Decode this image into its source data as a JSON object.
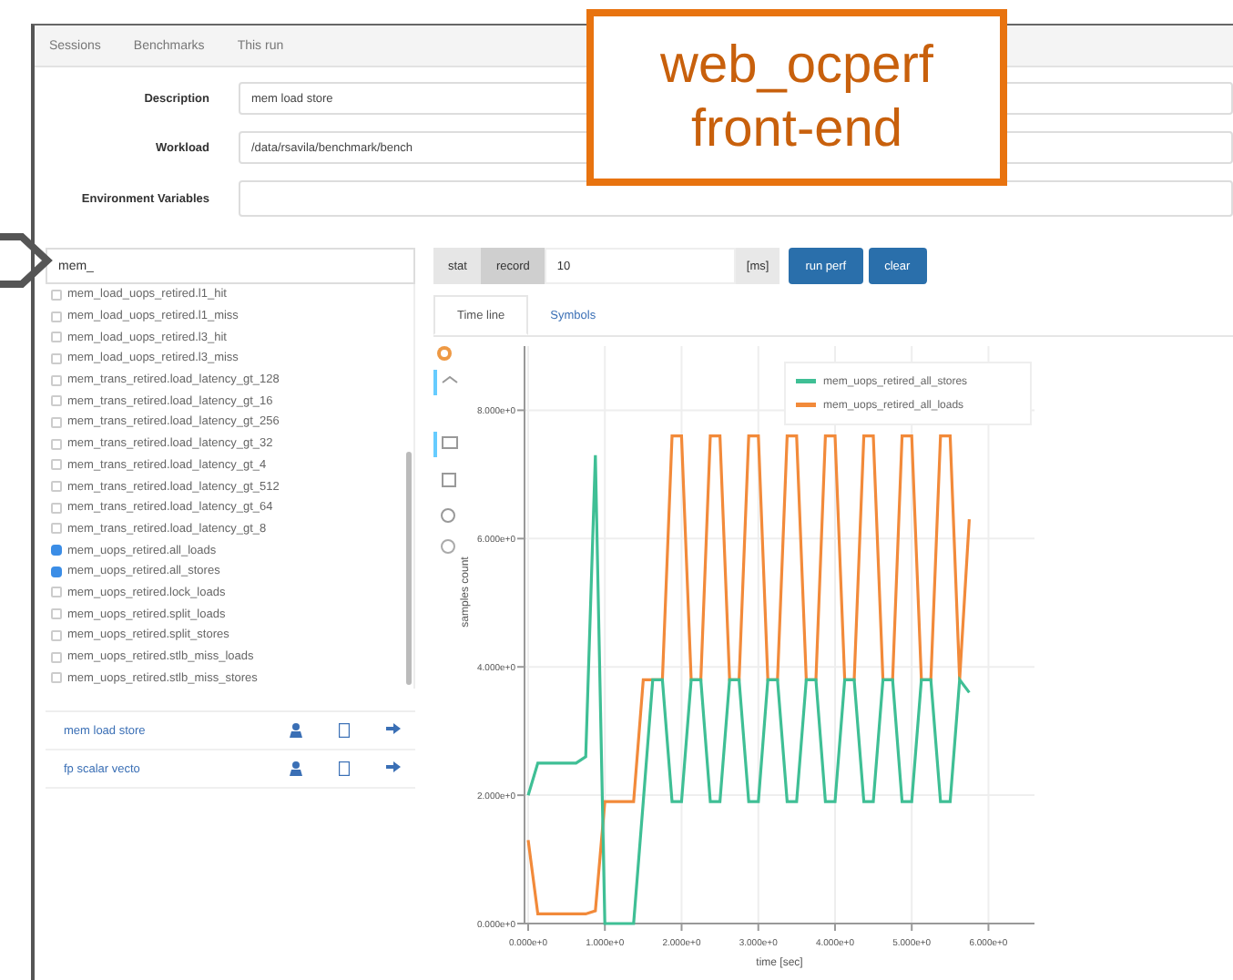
{
  "callout": {
    "lines": [
      "web_ocperf",
      "front-end"
    ]
  },
  "nav": [
    {
      "label": "Sessions"
    },
    {
      "label": "Benchmarks"
    },
    {
      "label": "This run"
    }
  ],
  "form": [
    {
      "label": "Description",
      "value": "mem load store"
    },
    {
      "label": "Workload",
      "value": "/data/rsavila/benchmark/bench"
    },
    {
      "label": "Environment Variables"
    }
  ],
  "filter": {
    "value": "mem_"
  },
  "events": [
    {
      "name": "mem_load_uops_retired.l1_hit",
      "checked": false
    },
    {
      "name": "mem_load_uops_retired.l1_miss",
      "checked": false
    },
    {
      "name": "mem_load_uops_retired.l3_hit",
      "checked": false
    },
    {
      "name": "mem_load_uops_retired.l3_miss",
      "checked": false
    },
    {
      "name": "mem_trans_retired.load_latency_gt_128",
      "checked": false
    },
    {
      "name": "mem_trans_retired.load_latency_gt_16",
      "checked": false
    },
    {
      "name": "mem_trans_retired.load_latency_gt_256",
      "checked": false
    },
    {
      "name": "mem_trans_retired.load_latency_gt_32",
      "checked": false
    },
    {
      "name": "mem_trans_retired.load_latency_gt_4",
      "checked": false
    },
    {
      "name": "mem_trans_retired.load_latency_gt_512",
      "checked": false
    },
    {
      "name": "mem_trans_retired.load_latency_gt_64",
      "checked": false
    },
    {
      "name": "mem_trans_retired.load_latency_gt_8",
      "checked": false
    },
    {
      "name": "mem_uops_retired.all_loads",
      "checked": true
    },
    {
      "name": "mem_uops_retired.all_stores",
      "checked": true
    },
    {
      "name": "mem_uops_retired.lock_loads",
      "checked": false
    },
    {
      "name": "mem_uops_retired.split_loads",
      "checked": false
    },
    {
      "name": "mem_uops_retired.split_stores",
      "checked": false
    },
    {
      "name": "mem_uops_retired.stlb_miss_loads",
      "checked": false
    },
    {
      "name": "mem_uops_retired.stlb_miss_stores",
      "checked": false
    }
  ],
  "saved": [
    {
      "name": "mem load store"
    },
    {
      "name": "fp scalar vecto"
    }
  ],
  "toolbar": {
    "modes": [
      {
        "label": "stat",
        "selected": false
      },
      {
        "label": "record",
        "selected": true
      }
    ],
    "interval": {
      "value": "10"
    },
    "unit": "[ms]",
    "buttons": [
      "run perf",
      "clear"
    ]
  },
  "tabs": [
    {
      "label": "Time line",
      "selected": true
    },
    {
      "label": "Symbols",
      "selected": false
    }
  ],
  "chart": {
    "chart_data": {
      "type": "line",
      "xlabel": "time [sec]",
      "ylabel": "samples count",
      "x": [
        0,
        0.125,
        0.25,
        0.375,
        0.5,
        0.625,
        0.75,
        0.875,
        1,
        1.125,
        1.25,
        1.375,
        1.5,
        1.625,
        1.75,
        1.875,
        2,
        2.125,
        2.25,
        2.375,
        2.5,
        2.625,
        2.75,
        2.875,
        3,
        3.125,
        3.25,
        3.375,
        3.5,
        3.625,
        3.75,
        3.875,
        4,
        4.125,
        4.25,
        4.375,
        4.5,
        4.625,
        4.75,
        4.875,
        5,
        5.125,
        5.25,
        5.375,
        5.5,
        5.625,
        5.75
      ],
      "series": [
        {
          "name": "mem_uops_retired_all_stores",
          "color": "#3fbf95",
          "values": [
            2.0,
            2.5,
            2.5,
            2.5,
            2.5,
            2.5,
            2.6,
            7.3,
            0,
            0,
            0,
            0,
            1.9,
            3.8,
            3.8,
            1.9,
            1.9,
            3.8,
            3.8,
            1.9,
            1.9,
            3.8,
            3.8,
            1.9,
            1.9,
            3.8,
            3.8,
            1.9,
            1.9,
            3.8,
            3.8,
            1.9,
            1.9,
            3.8,
            3.8,
            1.9,
            1.9,
            3.8,
            3.8,
            1.9,
            1.9,
            3.8,
            3.8,
            1.9,
            1.9,
            3.8,
            3.6
          ]
        },
        {
          "name": "mem_uops_retired_all_loads",
          "color": "#f28a3a",
          "values": [
            1.3,
            0.15,
            0.15,
            0.15,
            0.15,
            0.15,
            0.15,
            0.2,
            1.9,
            1.9,
            1.9,
            1.9,
            3.8,
            3.8,
            3.8,
            7.6,
            7.6,
            3.8,
            3.8,
            7.6,
            7.6,
            3.8,
            3.8,
            7.6,
            7.6,
            3.8,
            3.8,
            7.6,
            7.6,
            3.8,
            3.8,
            7.6,
            7.6,
            3.8,
            3.8,
            7.6,
            7.6,
            3.8,
            3.8,
            7.6,
            7.6,
            3.8,
            3.8,
            7.6,
            7.6,
            3.8,
            6.3
          ]
        }
      ],
      "grid": true,
      "legend": true,
      "xlim": [
        0,
        6.6
      ],
      "ylim": [
        0,
        9
      ],
      "yticks": [
        {
          "value": 0,
          "label": "0.000e+0"
        },
        {
          "value": 2,
          "label": "2.000e+0"
        },
        {
          "value": 4,
          "label": "4.000e+0"
        },
        {
          "value": 6,
          "label": "6.000e+0"
        },
        {
          "value": 8,
          "label": "8.000e+0"
        }
      ],
      "xticks": [
        {
          "value": 0,
          "label": "0.000e+0"
        },
        {
          "value": 1,
          "label": "1.000e+0"
        },
        {
          "value": 2,
          "label": "2.000e+0"
        },
        {
          "value": 3,
          "label": "3.000e+0"
        },
        {
          "value": 4,
          "label": "4.000e+0"
        },
        {
          "value": 5,
          "label": "5.000e+0"
        },
        {
          "value": 6,
          "label": "6.000e+0"
        }
      ]
    }
  }
}
